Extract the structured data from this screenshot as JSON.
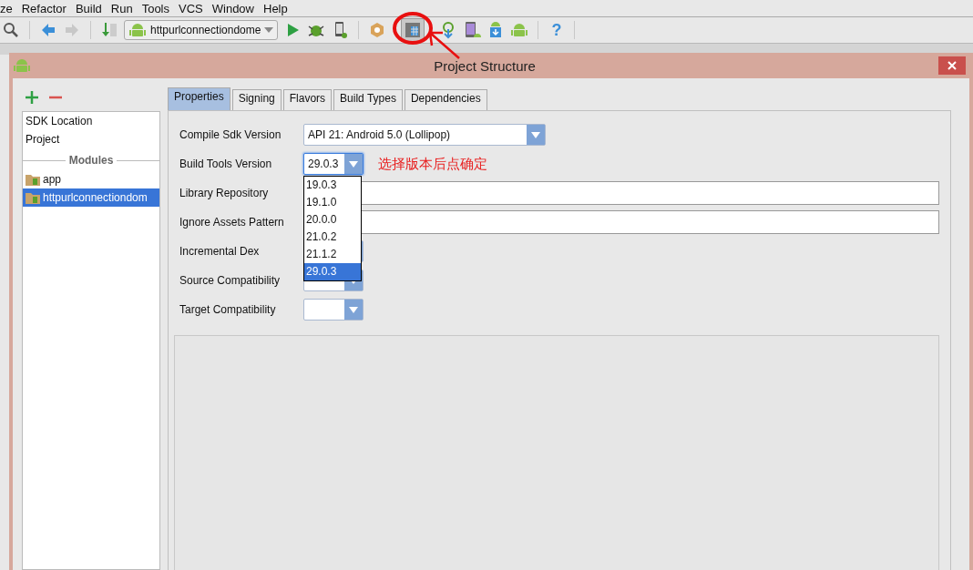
{
  "menu": [
    {
      "label": "ze"
    },
    {
      "label": "Refactor"
    },
    {
      "label": "Build"
    },
    {
      "label": "Run"
    },
    {
      "label": "Tools"
    },
    {
      "label": "VCS"
    },
    {
      "label": "Window"
    },
    {
      "label": "Help"
    }
  ],
  "toolbar": {
    "run_config": "httpurlconnectiondome",
    "help": "?",
    "project_structure_pressed": true
  },
  "dialog": {
    "title": "Project Structure",
    "sidebar": {
      "items": [
        {
          "label": "SDK Location",
          "selected": false
        },
        {
          "label": "Project",
          "selected": false
        }
      ],
      "modules_heading": "Modules",
      "modules": [
        {
          "label": "app",
          "selected": false
        },
        {
          "label": "httpurlconnectiondom",
          "selected": true
        }
      ]
    },
    "tabs": [
      {
        "label": "Properties",
        "selected": true
      },
      {
        "label": "Signing",
        "selected": false
      },
      {
        "label": "Flavors",
        "selected": false
      },
      {
        "label": "Build Types",
        "selected": false
      },
      {
        "label": "Dependencies",
        "selected": false
      }
    ],
    "fields": [
      {
        "kind": "wide_combo",
        "label": "Compile Sdk Version",
        "value": "API 21: Android 5.0 (Lollipop)"
      },
      {
        "kind": "combo",
        "label": "Build Tools Version",
        "value": "29.0.3",
        "expanded": true,
        "options": [
          {
            "label": "19.0.3",
            "selected": false
          },
          {
            "label": "19.1.0",
            "selected": false
          },
          {
            "label": "20.0.0",
            "selected": false
          },
          {
            "label": "21.0.2",
            "selected": false
          },
          {
            "label": "21.1.2",
            "selected": false
          },
          {
            "label": "29.0.3",
            "selected": true
          }
        ]
      },
      {
        "kind": "text",
        "label": "Library Repository"
      },
      {
        "kind": "text",
        "label": "Ignore Assets Pattern"
      },
      {
        "kind": "combo",
        "label": "Incremental Dex"
      },
      {
        "kind": "combo",
        "label": "Source Compatibility"
      },
      {
        "kind": "combo",
        "label": "Target Compatibility"
      }
    ]
  },
  "annotation": "选择版本后点确定"
}
